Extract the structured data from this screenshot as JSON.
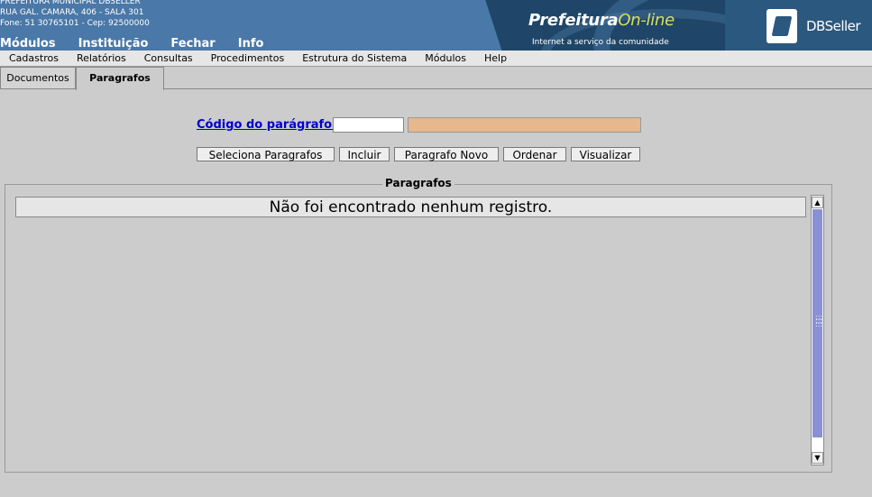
{
  "header": {
    "org_name": "PREFEITURA MUNICIPAL DBSELLER",
    "address": "RUA GAL. CAMARA, 406 - SALA 301",
    "phone": "Fone: 51 30765101  -  Cep: 92500000",
    "nav": [
      "Módulos",
      "Instituição",
      "Fechar",
      "Info"
    ]
  },
  "banner": {
    "brand_main": "Prefeitura",
    "brand_online": "On-line",
    "tagline": "Internet a serviço da comunidade",
    "vendor": "DBSeller"
  },
  "menubar": {
    "items": [
      "Cadastros",
      "Relatórios",
      "Consultas",
      "Procedimentos",
      "Estrutura do Sistema",
      "Módulos",
      "Help"
    ]
  },
  "tabs": [
    {
      "label": "Documentos",
      "active": false
    },
    {
      "label": "Paragrafos",
      "active": true
    }
  ],
  "form": {
    "codigo_label": "Código do parágrafo:",
    "codigo_value": "",
    "descricao_value": "",
    "buttons": [
      "Seleciona Paragrafos",
      "Incluir",
      "Paragrafo Novo",
      "Ordenar",
      "Visualizar"
    ]
  },
  "fieldset": {
    "legend": "Paragrafos",
    "empty_message": "Não foi encontrado nenhum registro."
  },
  "colors": {
    "header_bg": "#4a78a8",
    "banner_dark": "#1f4668",
    "page_bg": "#cccccc",
    "link": "#0000cc",
    "readonly_field": "#e6b88b",
    "scroll_thumb": "#8a90d4"
  }
}
